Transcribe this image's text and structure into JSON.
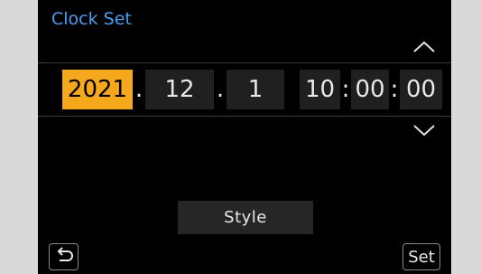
{
  "header": {
    "title": "Clock Set"
  },
  "icons": {
    "up": "chevron-up-icon",
    "down": "chevron-down-icon",
    "back": "return-arrow-icon"
  },
  "date": {
    "year": "2021",
    "month": "12",
    "day": "1",
    "separator": "."
  },
  "time": {
    "hour": "10",
    "minute": "00",
    "second": "00",
    "separator": ":"
  },
  "selected_field": "year",
  "buttons": {
    "style_label": "Style",
    "set_label": "Set"
  },
  "colors": {
    "title": "#4a9cf0",
    "selection": "#f6a81c",
    "screen": "#000000",
    "bezel": "#d9d9d9"
  }
}
